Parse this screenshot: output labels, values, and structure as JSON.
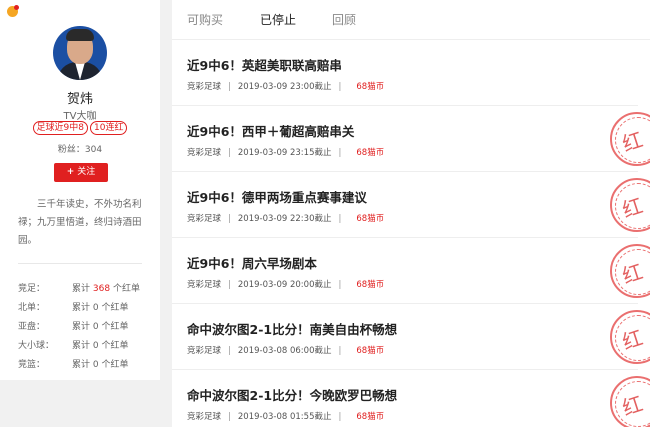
{
  "profile": {
    "name": "贺炜",
    "subtitle": "TV大咖",
    "tags": [
      "足球近9中8",
      "10连红"
    ],
    "fans": "粉丝：304",
    "follow_label": "关注",
    "follow_plus": "+",
    "bio": "三千年读史，不外功名利禄；九万里悟道，终归诗酒田园。",
    "stats": [
      {
        "label": "竞足：",
        "prefix": "累计",
        "num": "368",
        "suffix": "个红单"
      },
      {
        "label": "北单：",
        "prefix": "累计",
        "num": "0",
        "suffix": "个红单"
      },
      {
        "label": "亚盘：",
        "prefix": "累计",
        "num": "0",
        "suffix": "个红单"
      },
      {
        "label": "大小球：",
        "prefix": "累计",
        "num": "0",
        "suffix": "个红单"
      },
      {
        "label": "竞篮：",
        "prefix": "累计",
        "num": "0",
        "suffix": "个红单"
      }
    ]
  },
  "tabs": [
    "可购买",
    "已停止",
    "回顾"
  ],
  "active_tab": "已停止",
  "items": [
    {
      "title": "近9中6！英超美职联高赔串",
      "category": "竞彩足球",
      "deadline": "2019-03-09 23:00截止",
      "price": "68猫币",
      "stamp": ""
    },
    {
      "title": "近9中6！西甲＋葡超高赔串关",
      "category": "竞彩足球",
      "deadline": "2019-03-09 23:15截止",
      "price": "68猫币",
      "stamp": "红"
    },
    {
      "title": "近9中6！德甲两场重点赛事建议",
      "category": "竞彩足球",
      "deadline": "2019-03-09 22:30截止",
      "price": "68猫币",
      "stamp": "红"
    },
    {
      "title": "近9中6！周六早场剧本",
      "category": "竞彩足球",
      "deadline": "2019-03-09 20:00截止",
      "price": "68猫币",
      "stamp": "红"
    },
    {
      "title": "命中波尔图2-1比分！南美自由杯畅想",
      "category": "竞彩足球",
      "deadline": "2019-03-08 06:00截止",
      "price": "68猫币",
      "stamp": "红"
    },
    {
      "title": "命中波尔图2-1比分！今晚欧罗巴畅想",
      "category": "竞彩足球",
      "deadline": "2019-03-08 01:55截止",
      "price": "68猫币",
      "stamp": "红"
    }
  ],
  "colors": {
    "accent": "#e02020"
  }
}
